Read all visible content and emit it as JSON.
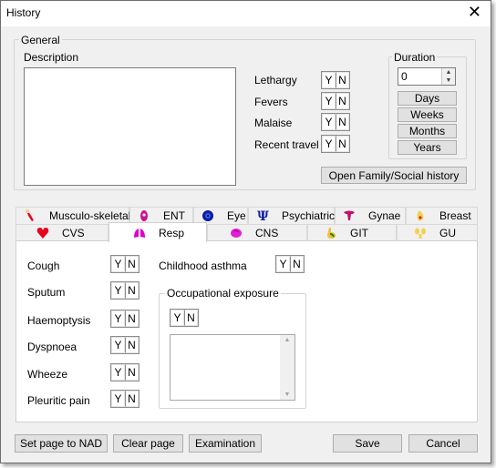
{
  "window": {
    "title": "History",
    "close_symbol": "✕"
  },
  "general": {
    "group_label": "General",
    "description_label": "Description",
    "description_value": "",
    "symptoms": [
      {
        "label": "Lethargy",
        "yes": "Y",
        "no": "N"
      },
      {
        "label": "Fevers",
        "yes": "Y",
        "no": "N"
      },
      {
        "label": "Malaise",
        "yes": "Y",
        "no": "N"
      },
      {
        "label": "Recent travel",
        "yes": "Y",
        "no": "N"
      }
    ],
    "duration": {
      "label": "Duration",
      "value": "0",
      "units": [
        "Days",
        "Weeks",
        "Months",
        "Years"
      ]
    },
    "family_social_button": "Open Family/Social history"
  },
  "tabs": {
    "row1": [
      {
        "label": "Musculo-skeletal",
        "icon": "bone-icon"
      },
      {
        "label": "ENT",
        "icon": "ent-icon"
      },
      {
        "label": "Eye",
        "icon": "eye-icon"
      },
      {
        "label": "Psychiatric",
        "icon": "psi-icon"
      },
      {
        "label": "Gynae",
        "icon": "uterus-icon"
      },
      {
        "label": "Breast",
        "icon": "breast-icon"
      }
    ],
    "row2": [
      {
        "label": "CVS",
        "icon": "heart-icon"
      },
      {
        "label": "Resp",
        "icon": "lungs-icon"
      },
      {
        "label": "CNS",
        "icon": "brain-icon"
      },
      {
        "label": "GIT",
        "icon": "stomach-icon"
      },
      {
        "label": "GU",
        "icon": "kidney-icon"
      }
    ],
    "active": "Resp"
  },
  "resp": {
    "symptoms": [
      {
        "label": "Cough",
        "yes": "Y",
        "no": "N"
      },
      {
        "label": "Sputum",
        "yes": "Y",
        "no": "N"
      },
      {
        "label": "Haemoptysis",
        "yes": "Y",
        "no": "N"
      },
      {
        "label": "Dyspnoea",
        "yes": "Y",
        "no": "N"
      },
      {
        "label": "Wheeze",
        "yes": "Y",
        "no": "N"
      },
      {
        "label": "Pleuritic pain",
        "yes": "Y",
        "no": "N"
      }
    ],
    "childhood_asthma": {
      "label": "Childhood asthma",
      "yes": "Y",
      "no": "N"
    },
    "occupational": {
      "label": "Occupational exposure",
      "yes": "Y",
      "no": "N",
      "notes": ""
    }
  },
  "buttons": {
    "nad": "Set page to NAD",
    "clear": "Clear page",
    "exam": "Examination",
    "save": "Save",
    "cancel": "Cancel"
  },
  "colors": {
    "heart": "#e8001c",
    "lungs": "#e000c8",
    "brain": "#e020d0",
    "psi": "#1020a0",
    "uterus": "#c01070"
  }
}
